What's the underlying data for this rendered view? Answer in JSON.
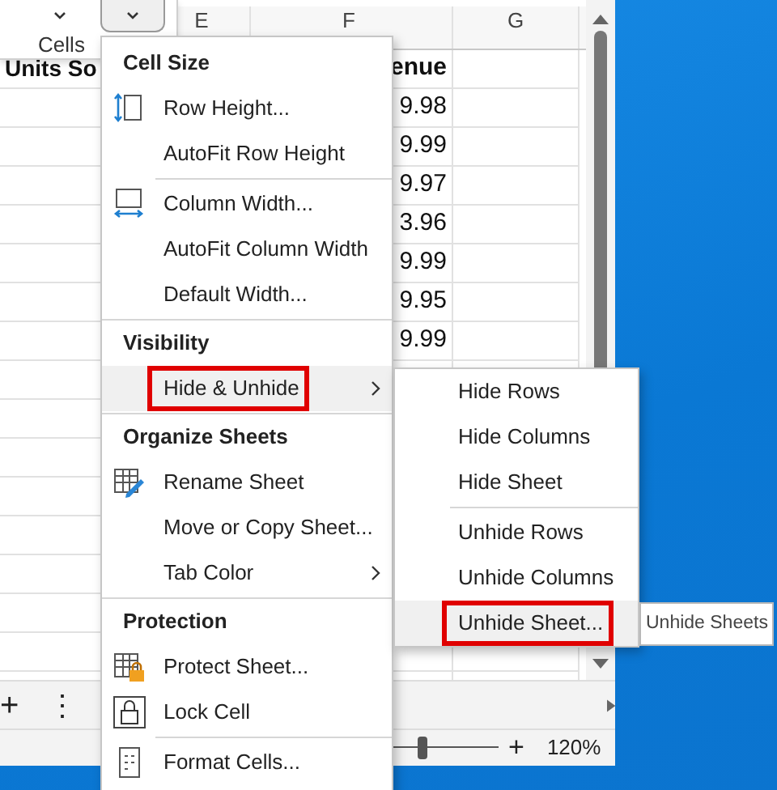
{
  "ribbon": {
    "group_label": "Cells",
    "dropdowns": [
      {
        "pressed": false
      },
      {
        "pressed": true
      }
    ]
  },
  "grid": {
    "column_headers": [
      "E",
      "F",
      "G"
    ],
    "header_row": {
      "left": "Units So",
      "F": "enue"
    },
    "value_rows": [
      {
        "F": "9.98"
      },
      {
        "F": "9.99"
      },
      {
        "F": "9.97"
      },
      {
        "F": "3.96"
      },
      {
        "F": "9.99"
      },
      {
        "F": "9.95"
      },
      {
        "F": "9.99"
      }
    ]
  },
  "sheet_bar": {
    "add_button": "+",
    "more_button": "⋮"
  },
  "status_bar": {
    "zoom_slider": {
      "level": 0.57
    },
    "zoom_in": "+",
    "zoom": "120%"
  },
  "menu": {
    "sections": [
      {
        "heading": "Cell Size",
        "items": [
          {
            "kind": "rowheight",
            "label": "Row Height...",
            "submenu": false,
            "highlighted": false,
            "annotated": false
          },
          {
            "kind": "plain",
            "label": "AutoFit Row Height",
            "submenu": false,
            "highlighted": false,
            "annotated": false
          },
          {
            "kind": "separator"
          },
          {
            "kind": "colwidth",
            "label": "Column Width...",
            "submenu": false,
            "highlighted": false,
            "annotated": false
          },
          {
            "kind": "plain",
            "label": "AutoFit Column Width",
            "submenu": false,
            "highlighted": false,
            "annotated": false
          },
          {
            "kind": "plain",
            "label": "Default Width...",
            "submenu": false,
            "highlighted": false,
            "annotated": false
          }
        ]
      },
      {
        "heading": "Visibility",
        "items": [
          {
            "kind": "plain",
            "label": "Hide & Unhide",
            "submenu": true,
            "highlighted": true,
            "annotated": true
          }
        ]
      },
      {
        "heading": "Organize Sheets",
        "items": [
          {
            "kind": "rename",
            "label": "Rename Sheet",
            "submenu": false,
            "highlighted": false,
            "annotated": false
          },
          {
            "kind": "plain",
            "label": "Move or Copy Sheet...",
            "submenu": false,
            "highlighted": false,
            "annotated": false
          },
          {
            "kind": "plain",
            "label": "Tab Color",
            "submenu": true,
            "highlighted": false,
            "annotated": false
          }
        ]
      },
      {
        "heading": "Protection",
        "items": [
          {
            "kind": "protect",
            "label": "Protect Sheet...",
            "submenu": false,
            "highlighted": false,
            "annotated": false
          },
          {
            "kind": "lock",
            "label": "Lock Cell",
            "submenu": false,
            "highlighted": false,
            "annotated": false
          },
          {
            "kind": "separator"
          },
          {
            "kind": "format",
            "label": "Format Cells...",
            "submenu": false,
            "highlighted": false,
            "annotated": false
          }
        ]
      }
    ]
  },
  "submenu": {
    "items": [
      {
        "kind": "plain",
        "label": "Hide Rows",
        "highlighted": false,
        "annotated": false
      },
      {
        "kind": "plain",
        "label": "Hide Columns",
        "highlighted": false,
        "annotated": false
      },
      {
        "kind": "plain",
        "label": "Hide Sheet",
        "highlighted": false,
        "annotated": false
      },
      {
        "kind": "separator"
      },
      {
        "kind": "plain",
        "label": "Unhide Rows",
        "highlighted": false,
        "annotated": false
      },
      {
        "kind": "plain",
        "label": "Unhide Columns",
        "highlighted": false,
        "annotated": false
      },
      {
        "kind": "plain",
        "label": "Unhide Sheet...",
        "highlighted": true,
        "annotated": true
      }
    ]
  },
  "tooltip": "Unhide Sheets"
}
